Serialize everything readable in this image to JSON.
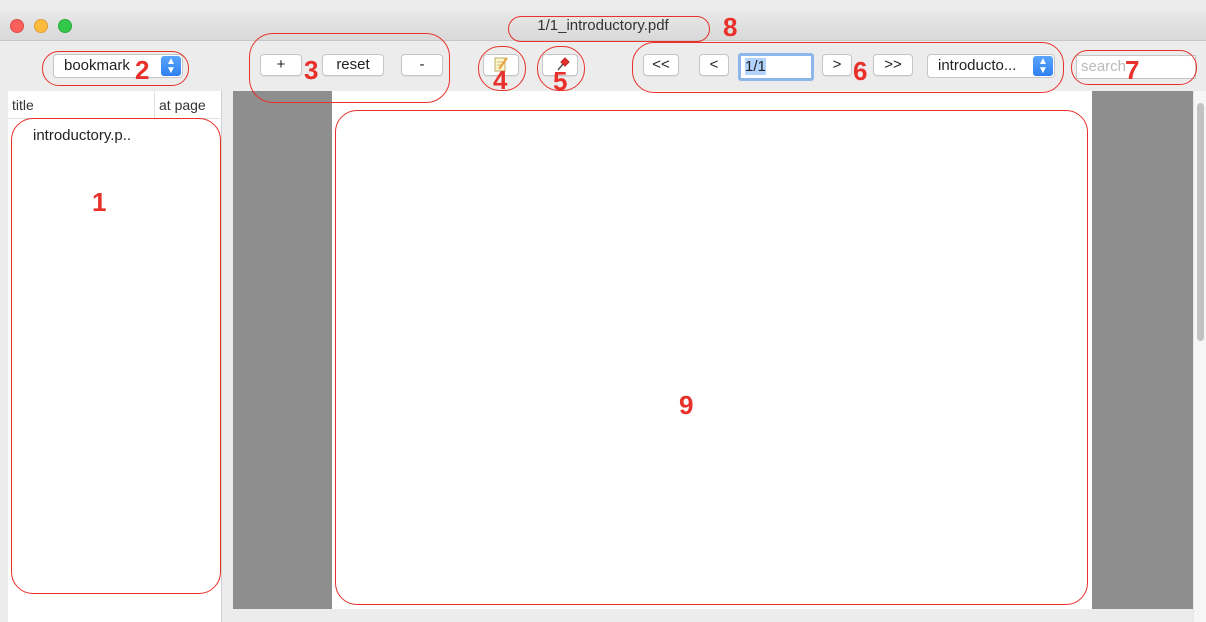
{
  "window": {
    "title": "1/1_introductory.pdf"
  },
  "toolbar": {
    "view_select": "bookmark",
    "zoom_in_label": "+",
    "zoom_reset_label": "reset",
    "zoom_out_label": "-",
    "annotate_icon": "note-edit-icon",
    "pin_icon": "pushpin-icon",
    "first_page_label": "<<",
    "prev_page_label": "<",
    "page_field_value": "1/1",
    "next_page_label": ">",
    "last_page_label": ">>",
    "document_select": "introducto...",
    "search_placeholder": "search"
  },
  "sidebar": {
    "columns": [
      "title",
      "at page"
    ],
    "rows": [
      {
        "title": "introductory.p..",
        "page": ""
      }
    ]
  },
  "annotations": [
    "1",
    "2",
    "3",
    "4",
    "5",
    "6",
    "7",
    "8",
    "9"
  ],
  "colors": {
    "annotation": "#e8312a",
    "accent": "#2f7fef",
    "document_background": "#8e8e8e"
  }
}
